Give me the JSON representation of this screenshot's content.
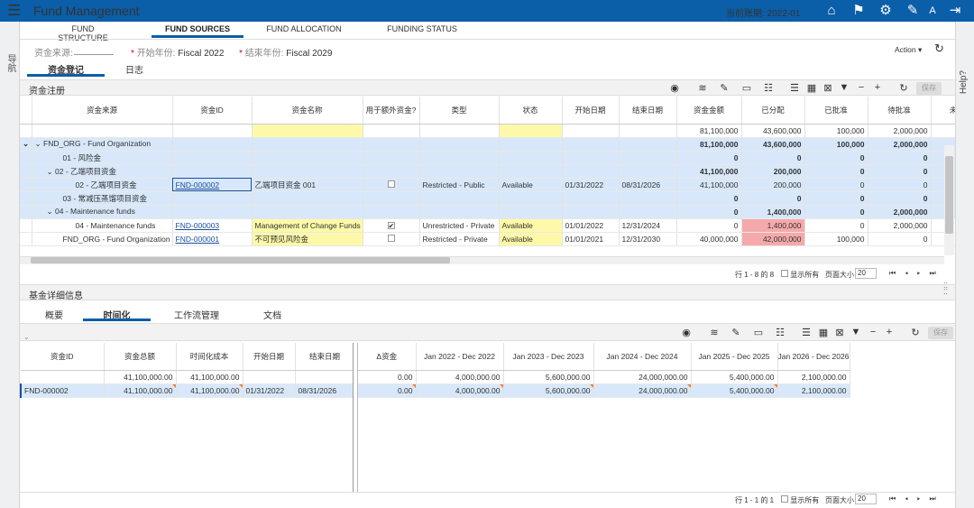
{
  "app": {
    "title": "Fund Management",
    "period": "当前账期: 2022-01",
    "left_nav": "导航",
    "help": "Help?"
  },
  "top_tabs": [
    "FUND STRUCTURE",
    "FUND SOURCES",
    "FUND ALLOCATION",
    "FUNDING STATUS"
  ],
  "filters": {
    "source_label": "资金来源:",
    "start_label": "开始年份:",
    "start_value": "Fiscal 2022",
    "end_label": "结束年份:",
    "end_value": "Fiscal 2029",
    "action": "Action ▾"
  },
  "sub_tabs": [
    "资金登记",
    "日志"
  ],
  "reg": {
    "title": "资金注册",
    "save": "保存",
    "columns": [
      "资金来源",
      "资金ID",
      "资金名称",
      "用于额外资金?",
      "类型",
      "状态",
      "开始日期",
      "结束日期",
      "资金金额",
      "已分配",
      "已批准",
      "待批准",
      "未"
    ],
    "totals": [
      "81,100,000",
      "43,600,000",
      "100,000",
      "2,000,000"
    ],
    "rows": [
      {
        "name": "FND_ORG - Fund Organization",
        "id": "",
        "fname": "",
        "chk": "",
        "type": "",
        "status": "",
        "start": "",
        "end": "",
        "amt": "81,100,000",
        "alloc": "43,600,000",
        "appr": "100,000",
        "pend": "2,000,000"
      },
      {
        "name": "01 - 风险金",
        "id": "",
        "fname": "",
        "chk": "",
        "type": "",
        "status": "",
        "start": "",
        "end": "",
        "amt": "0",
        "alloc": "0",
        "appr": "0",
        "pend": "0"
      },
      {
        "name": "02 - 乙端项目资金",
        "id": "",
        "fname": "",
        "chk": "",
        "type": "",
        "status": "",
        "start": "",
        "end": "",
        "amt": "41,100,000",
        "alloc": "200,000",
        "appr": "0",
        "pend": "0"
      },
      {
        "name": "02 - 乙端项目资金",
        "id": "FND-000002",
        "fname": "乙端项目资金 001",
        "chk": "",
        "type": "Restricted - Public",
        "status": "Available",
        "start": "01/31/2022",
        "end": "08/31/2026",
        "amt": "41,100,000",
        "alloc": "200,000",
        "appr": "0",
        "pend": "0"
      },
      {
        "name": "03 - 常减压蒸馏项目资金",
        "id": "",
        "fname": "",
        "chk": "",
        "type": "",
        "status": "",
        "start": "",
        "end": "",
        "amt": "0",
        "alloc": "0",
        "appr": "0",
        "pend": "0"
      },
      {
        "name": "04 - Maintenance funds",
        "id": "",
        "fname": "",
        "chk": "",
        "type": "",
        "status": "",
        "start": "",
        "end": "",
        "amt": "0",
        "alloc": "1,400,000",
        "appr": "0",
        "pend": "2,000,000"
      },
      {
        "name": "04 - Maintenance funds",
        "id": "FND-000003",
        "fname": "Management of Change Funds",
        "chk": "✔",
        "type": "Unrestricted - Private",
        "status": "Available",
        "start": "01/01/2022",
        "end": "12/31/2024",
        "amt": "0",
        "alloc": "1,400,000",
        "appr": "0",
        "pend": "2,000,000"
      },
      {
        "name": "FND_ORG - Fund Organization",
        "id": "FND-000001",
        "fname": "不可预见风险金",
        "chk": "",
        "type": "Restricted - Private",
        "status": "Available",
        "start": "01/01/2021",
        "end": "12/31/2030",
        "amt": "40,000,000",
        "alloc": "42,000,000",
        "appr": "100,000",
        "pend": "0"
      }
    ],
    "pager": "行 1 - 8 的 8",
    "show_all": "显示所有",
    "page_size_label": "页面大小",
    "page_size": "20"
  },
  "detail": {
    "title": "基金详细信息",
    "tabs": [
      "概要",
      "时间化",
      "工作流管理",
      "文档"
    ],
    "left_cols": [
      "资金ID",
      "资金总额",
      "时间化成本",
      "开始日期",
      "结束日期"
    ],
    "left_totals": [
      "41,100,000.00",
      "41,100,000.00"
    ],
    "left_row": [
      "FND-000002",
      "41,100,000.00",
      "41,100,000.00",
      "01/31/2022",
      "08/31/2026"
    ],
    "right_cols": [
      "Δ资金",
      "Jan 2022 - Dec 2022",
      "Jan 2023 - Dec 2023",
      "Jan 2024 - Dec 2024",
      "Jan 2025 - Dec 2025",
      "Jan 2026 - Dec 2026"
    ],
    "right_totals": [
      "0.00",
      "4,000,000.00",
      "5,600,000.00",
      "24,000,000.00",
      "5,400,000.00",
      "2,100,000.00"
    ],
    "right_row": [
      "0.00",
      "4,000,000.00",
      "5,600,000.00",
      "24,000,000.00",
      "5,400,000.00",
      "2,100,000.00"
    ],
    "pager": "行 1 - 1 的 1",
    "show_all": "显示所有",
    "page_size_label": "页面大小",
    "page_size": "20",
    "save": "保存"
  }
}
